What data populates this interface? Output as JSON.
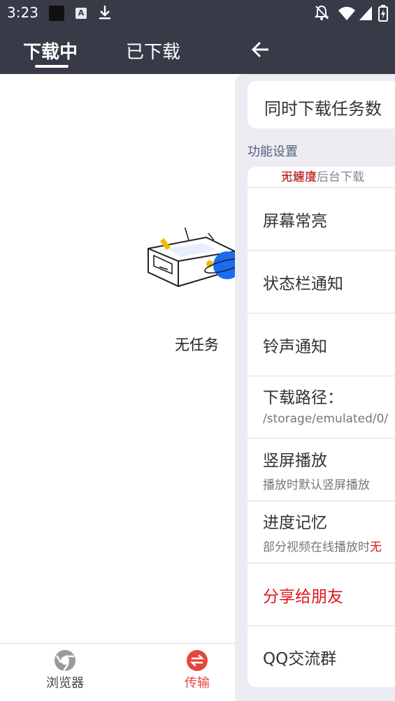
{
  "status_bar": {
    "time": "3:23",
    "left_icons": [
      "square-notification-icon",
      "a-notification-icon",
      "download-icon"
    ],
    "right_icons": [
      "bell-off-icon",
      "wifi-icon",
      "signal-icon",
      "battery-icon"
    ],
    "a_glyph": "A"
  },
  "tabs": [
    {
      "label": "下载中",
      "active": true
    },
    {
      "label": "已下载",
      "active": false
    }
  ],
  "empty_state": {
    "text": "无任务"
  },
  "bottom_nav": [
    {
      "label": "浏览器",
      "icon": "browser-icon",
      "color": "#444444"
    },
    {
      "label": "传输",
      "icon": "transfer-icon",
      "color": "#e5463d"
    }
  ],
  "drawer": {
    "back_icon": "back-arrow-icon",
    "top_item": "同时下载任务数",
    "section_title": "功能设置",
    "partial_item": {
      "text": "可解决后台下载",
      "highlight": "无速度"
    },
    "items": [
      {
        "title": "屏幕常亮"
      },
      {
        "title": "状态栏通知"
      },
      {
        "title": "铃声通知"
      },
      {
        "title": "下载路径：",
        "subtitle": "/storage/emulated/0/"
      },
      {
        "title": "竖屏播放",
        "subtitle": "播放时默认竖屏播放"
      },
      {
        "title": "进度记忆",
        "subtitle": "部分视频在线播放时",
        "subtitle_highlight": "无"
      },
      {
        "title": "分享给朋友",
        "accent": true
      },
      {
        "title": "QQ交流群"
      }
    ]
  },
  "colors": {
    "header_bg": "#383a48",
    "accent_red": "#e0151a",
    "drawer_bg": "#ececf2",
    "planet_blue": "#1a6cf0",
    "tag_yellow": "#f5b800"
  }
}
